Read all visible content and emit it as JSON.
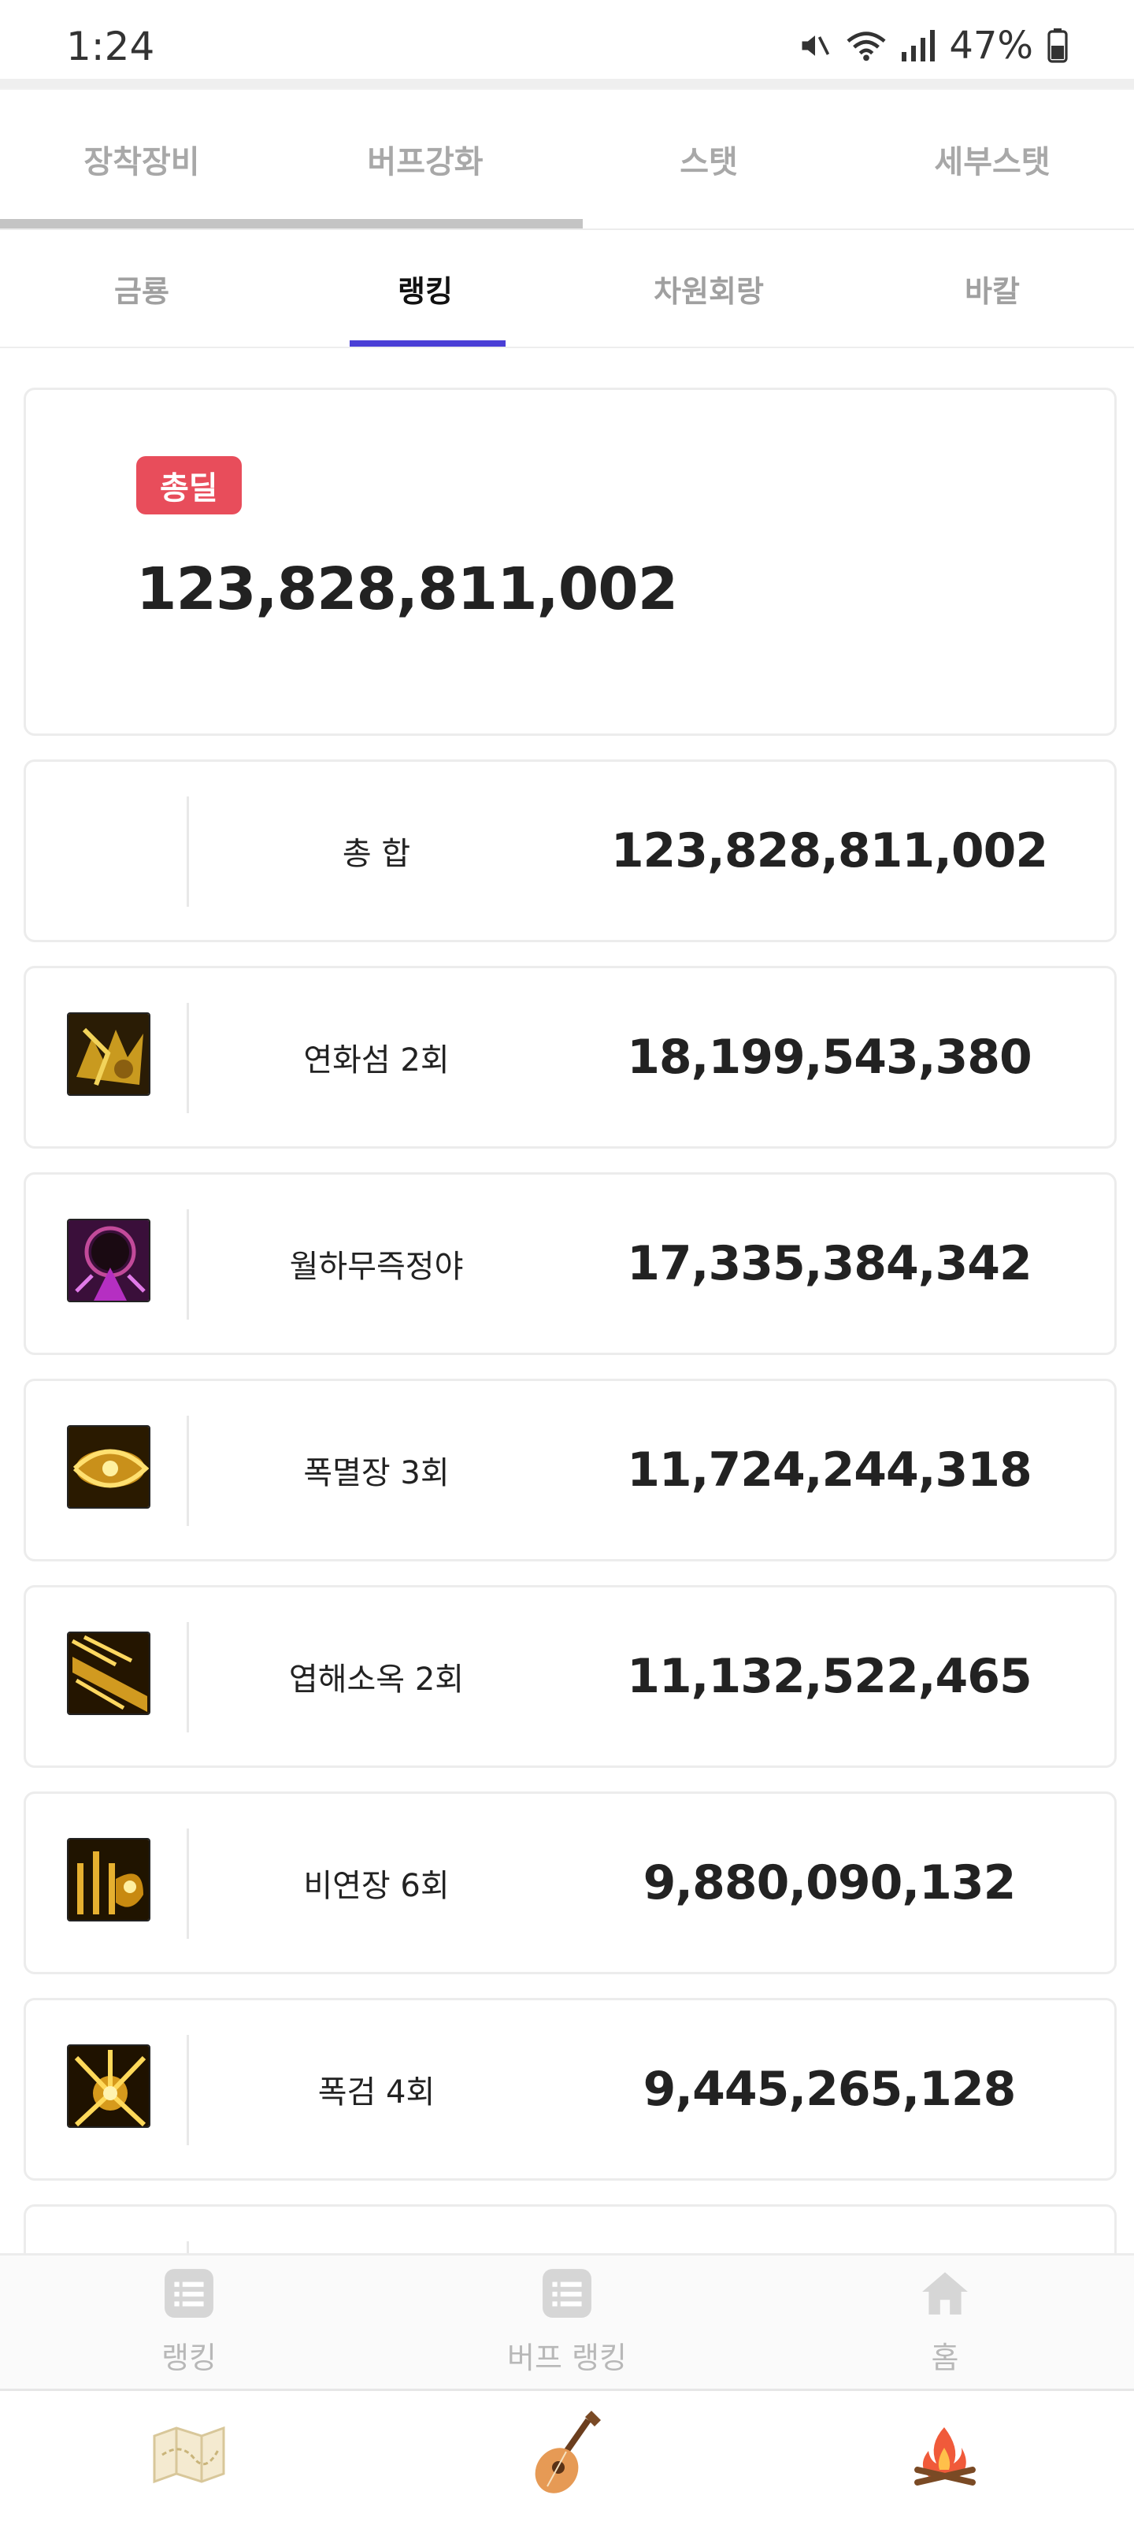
{
  "status_bar": {
    "time": "1:24",
    "battery": "47%"
  },
  "tabs_primary": [
    {
      "label": "장착장비"
    },
    {
      "label": "버프강화"
    },
    {
      "label": "스탯"
    },
    {
      "label": "세부스탯"
    }
  ],
  "tabs_secondary": [
    {
      "label": "금룡"
    },
    {
      "label": "랭킹"
    },
    {
      "label": "차원회랑"
    },
    {
      "label": "바칼"
    }
  ],
  "summary": {
    "badge": "총딜",
    "total": "123,828,811,002"
  },
  "rows": [
    {
      "name": "총 합",
      "value": "123,828,811,002",
      "icon": "none"
    },
    {
      "name": "연화섬 2회",
      "value": "18,199,543,380",
      "icon": "skill-icon"
    },
    {
      "name": "월하무즉정야",
      "value": "17,335,384,342",
      "icon": "skill-icon"
    },
    {
      "name": "폭멸장 3회",
      "value": "11,724,244,318",
      "icon": "skill-icon"
    },
    {
      "name": "엽해소옥 2회",
      "value": "11,132,522,465",
      "icon": "skill-icon"
    },
    {
      "name": "비연장 6회",
      "value": "9,880,090,132",
      "icon": "skill-icon"
    },
    {
      "name": "폭검 4회",
      "value": "9,445,265,128",
      "icon": "skill-icon"
    }
  ],
  "bottom_nav": [
    {
      "label": "랭킹",
      "icon": "list-icon"
    },
    {
      "label": "버프 랭킹",
      "icon": "list-icon"
    },
    {
      "label": "홈",
      "icon": "home-icon"
    }
  ],
  "app_dock": [
    {
      "icon": "map-icon"
    },
    {
      "icon": "guitar-icon"
    },
    {
      "icon": "campfire-icon"
    }
  ],
  "colors": {
    "accent": "#4a3fd6",
    "badge": "#e84d5b",
    "nav_inactive": "#b8b8b8"
  }
}
